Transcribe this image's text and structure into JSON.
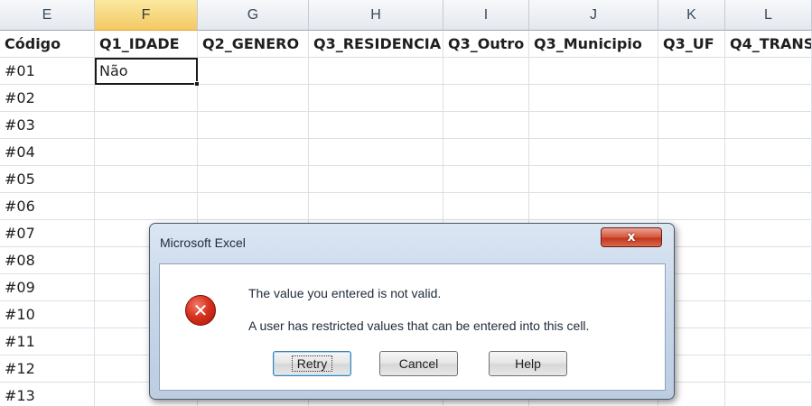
{
  "columns": [
    {
      "letter": "E",
      "selected": false
    },
    {
      "letter": "F",
      "selected": true
    },
    {
      "letter": "G",
      "selected": false
    },
    {
      "letter": "H",
      "selected": false
    },
    {
      "letter": "I",
      "selected": false
    },
    {
      "letter": "J",
      "selected": false
    },
    {
      "letter": "K",
      "selected": false
    },
    {
      "letter": "L",
      "selected": false
    }
  ],
  "header_row": [
    "Código",
    "Q1_IDADE",
    "Q2_GENERO",
    "Q3_RESIDENCIA",
    "Q3_Outro",
    "Q3_Municipio",
    "Q3_UF",
    "Q4_TRANS"
  ],
  "rows": [
    [
      "#01",
      "Não"
    ],
    [
      "#02",
      ""
    ],
    [
      "#03",
      ""
    ],
    [
      "#04",
      ""
    ],
    [
      "#05",
      ""
    ],
    [
      "#06",
      ""
    ],
    [
      "#07",
      ""
    ],
    [
      "#08",
      ""
    ],
    [
      "#09",
      ""
    ],
    [
      "#10",
      ""
    ],
    [
      "#11",
      ""
    ],
    [
      "#12",
      ""
    ],
    [
      "#13",
      ""
    ]
  ],
  "dialog": {
    "title": "Microsoft Excel",
    "close_label": "x",
    "icon": "error-icon",
    "message_line1": "The value you entered is not valid.",
    "message_line2": "A user has restricted values that can be entered into this cell.",
    "buttons": {
      "retry": "Retry",
      "cancel": "Cancel",
      "help": "Help"
    }
  },
  "colors": {
    "selected_header": "#f3c963",
    "error_red": "#d7321f",
    "dialog_frame": "#c9d8ea"
  }
}
